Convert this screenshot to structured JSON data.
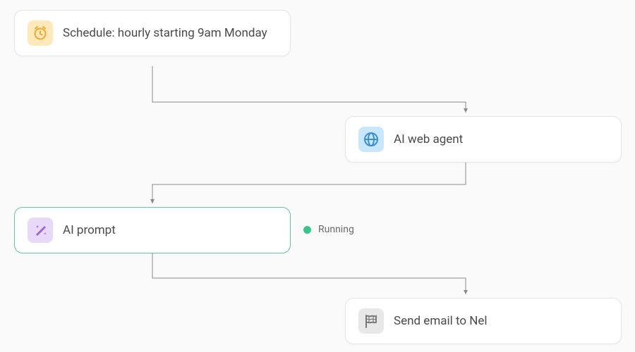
{
  "nodes": {
    "schedule": {
      "label": "Schedule: hourly starting 9am Monday",
      "icon": "clock-icon"
    },
    "web_agent": {
      "label": "AI web agent",
      "icon": "globe-icon"
    },
    "prompt": {
      "label": "AI prompt",
      "icon": "wand-icon",
      "status": "Running"
    },
    "email": {
      "label": "Send email to Nel",
      "icon": "flag-icon"
    }
  },
  "colors": {
    "schedule_bg": "#ffe9b8",
    "schedule_fg": "#f0a830",
    "web_bg": "#c9e7fa",
    "web_fg": "#3a8fd4",
    "prompt_bg": "#e9d9f9",
    "prompt_fg": "#9966d8",
    "email_bg": "#e8e8e8",
    "email_fg": "#7a7a7a",
    "active_border": "#5ec9a0",
    "status_dot": "#35c788"
  }
}
